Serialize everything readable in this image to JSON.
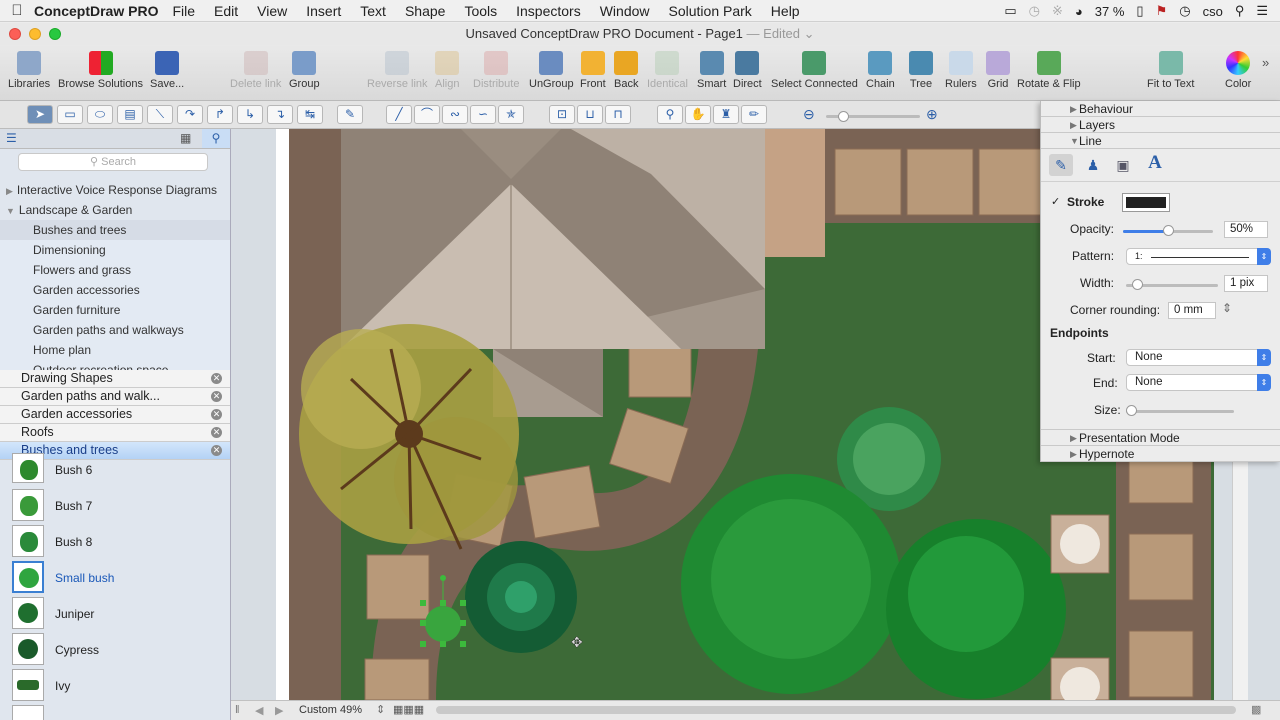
{
  "menubar": {
    "app_name": "ConceptDraw PRO",
    "items": [
      "File",
      "Edit",
      "View",
      "Insert",
      "Text",
      "Shape",
      "Tools",
      "Inspectors",
      "Window",
      "Solution Park",
      "Help"
    ],
    "battery": "37 %",
    "user": "cso"
  },
  "window": {
    "title": "Unsaved ConceptDraw PRO Document - Page1",
    "edited": "— Edited ⌄"
  },
  "toolbar": {
    "buttons": [
      {
        "label": "Libraries",
        "icon": "libraries-icon"
      },
      {
        "label": "Browse Solutions",
        "icon": "browse-solutions-icon"
      },
      {
        "label": "Save...",
        "icon": "save-icon"
      },
      {
        "label": "Delete link",
        "icon": "delete-link-icon"
      },
      {
        "label": "Group",
        "icon": "group-icon"
      },
      {
        "label": "Reverse link",
        "icon": "reverse-link-icon"
      },
      {
        "label": "Align",
        "icon": "align-icon"
      },
      {
        "label": "Distribute",
        "icon": "distribute-icon"
      },
      {
        "label": "UnGroup",
        "icon": "ungroup-icon"
      },
      {
        "label": "Front",
        "icon": "front-icon"
      },
      {
        "label": "Back",
        "icon": "back-icon"
      },
      {
        "label": "Identical",
        "icon": "identical-icon"
      },
      {
        "label": "Smart",
        "icon": "smart-connector-icon"
      },
      {
        "label": "Direct",
        "icon": "direct-connector-icon"
      },
      {
        "label": "Select Connected",
        "icon": "select-connected-icon"
      },
      {
        "label": "Chain",
        "icon": "chain-icon"
      },
      {
        "label": "Tree",
        "icon": "tree-icon"
      },
      {
        "label": "Rulers",
        "icon": "rulers-icon"
      },
      {
        "label": "Grid",
        "icon": "grid-icon"
      },
      {
        "label": "Rotate & Flip",
        "icon": "rotate-flip-icon"
      },
      {
        "label": "Fit to Text",
        "icon": "fit-to-text-icon"
      },
      {
        "label": "Color",
        "icon": "color-wheel-icon"
      }
    ]
  },
  "sidebar": {
    "search_placeholder": "Search",
    "tree": [
      {
        "label": "Interactive Voice Response Diagrams"
      },
      {
        "label": "Landscape & Garden"
      },
      {
        "label": "Bushes and trees"
      },
      {
        "label": "Dimensioning"
      },
      {
        "label": "Flowers and grass"
      },
      {
        "label": "Garden accessories"
      },
      {
        "label": "Garden furniture"
      },
      {
        "label": "Garden paths and walkways"
      },
      {
        "label": "Home plan"
      },
      {
        "label": "Outdoor recreation space"
      }
    ],
    "libraries": [
      "Drawing Shapes",
      "Garden paths and walk...",
      "Garden accessories",
      "Roofs",
      "Bushes and trees"
    ],
    "shapes": [
      "Bush 6",
      "Bush 7",
      "Bush 8",
      "Small bush",
      "Juniper",
      "Cypress",
      "Ivy"
    ]
  },
  "inspector": {
    "sections": [
      "Behaviour",
      "Layers",
      "Line"
    ],
    "stroke_label": "Stroke",
    "stroke_checked": true,
    "stroke_color": "#222222",
    "opacity_label": "Opacity:",
    "opacity_value": "50%",
    "pattern_label": "Pattern:",
    "pattern_value": "1:",
    "width_label": "Width:",
    "width_value": "1 pix",
    "corner_label": "Corner rounding:",
    "corner_value": "0 mm",
    "endpoints_label": "Endpoints",
    "start_label": "Start:",
    "start_value": "None",
    "end_label": "End:",
    "end_value": "None",
    "size_label": "Size:",
    "bottom_sections": [
      "Presentation Mode",
      "Hypernote"
    ]
  },
  "status": {
    "zoom": "Custom 49%"
  },
  "colors": {
    "accent": "#3f7ee8",
    "lawn": "#3d6a37",
    "path": "#7a6354",
    "paver": "#b89979"
  }
}
